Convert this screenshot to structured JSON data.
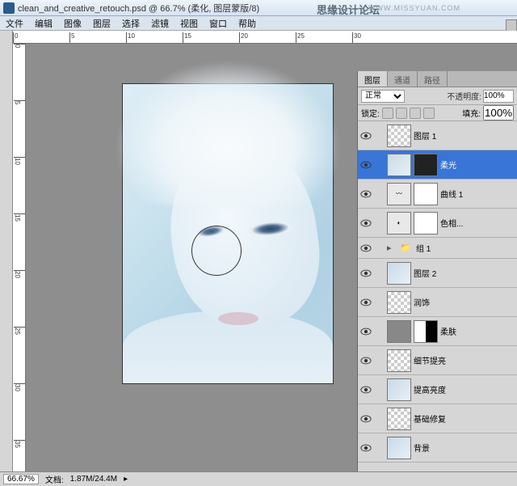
{
  "title": "clean_and_creative_retouch.psd @ 66.7% (柔化, 图层蒙版/8)",
  "watermark": "思缘设计论坛",
  "watermark_url": "WWW.MISSYUAN.COM",
  "menu": [
    "文件",
    "编辑",
    "图像",
    "图层",
    "选择",
    "滤镜",
    "视图",
    "窗口",
    "帮助"
  ],
  "tabs": {
    "active": "图层",
    "others": [
      "通道",
      "路径"
    ]
  },
  "blend": {
    "mode": "正常",
    "opacity_label": "不透明度:",
    "opacity": "100%",
    "lock_label": "锁定:",
    "fill_label": "填充:",
    "fill": "100%"
  },
  "layers": [
    {
      "name": "图层 1",
      "type": "checker"
    },
    {
      "name": "柔光",
      "type": "img",
      "mask": "dark",
      "sel": true
    },
    {
      "name": "曲线 1",
      "type": "adj",
      "mask": "white",
      "adjtxt": "〰"
    },
    {
      "name": "色相...",
      "type": "adj",
      "mask": "white",
      "adjtxt": "◐"
    },
    {
      "name": "组 1",
      "type": "group"
    },
    {
      "name": "图层 2",
      "type": "img"
    },
    {
      "name": "润饰",
      "type": "checker"
    },
    {
      "name": "柔肤",
      "type": "gray",
      "mask": "bw"
    },
    {
      "name": "细节提亮",
      "type": "checker"
    },
    {
      "name": "提高亮度",
      "type": "img-light"
    },
    {
      "name": "基础修复",
      "type": "checker"
    },
    {
      "name": "背景",
      "type": "img"
    }
  ],
  "status": {
    "zoom": "66.67%",
    "doc_label": "文档:",
    "doc": "1.87M/24.4M"
  },
  "ruler_h": [
    0,
    5,
    10,
    15,
    20,
    25,
    30
  ],
  "ruler_v": [
    0,
    5,
    10,
    15,
    20,
    25,
    30,
    35
  ]
}
